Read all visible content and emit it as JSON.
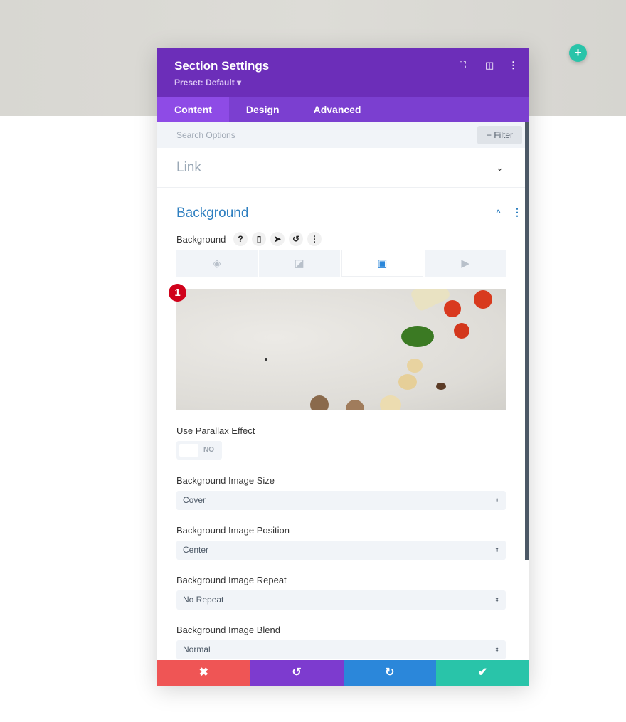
{
  "modal": {
    "title": "Section Settings",
    "preset": "Preset: Default ▾"
  },
  "tabs": [
    {
      "label": "Content"
    },
    {
      "label": "Design"
    },
    {
      "label": "Advanced"
    }
  ],
  "search": {
    "placeholder": "Search Options",
    "filter_label": "+ Filter"
  },
  "sections": {
    "link": "Link",
    "background": "Background"
  },
  "background": {
    "label": "Background",
    "badge": "1"
  },
  "parallax": {
    "label": "Use Parallax Effect",
    "value": "NO"
  },
  "fields": [
    {
      "label": "Background Image Size",
      "value": "Cover"
    },
    {
      "label": "Background Image Position",
      "value": "Center"
    },
    {
      "label": "Background Image Repeat",
      "value": "No Repeat"
    },
    {
      "label": "Background Image Blend",
      "value": "Normal"
    }
  ],
  "colors": {
    "header": "#6c2eb9",
    "tabs": "#7b3fd0",
    "cancel": "#ef5555",
    "undo": "#7d3bcf",
    "redo": "#2b87da",
    "save": "#29c4a9"
  }
}
